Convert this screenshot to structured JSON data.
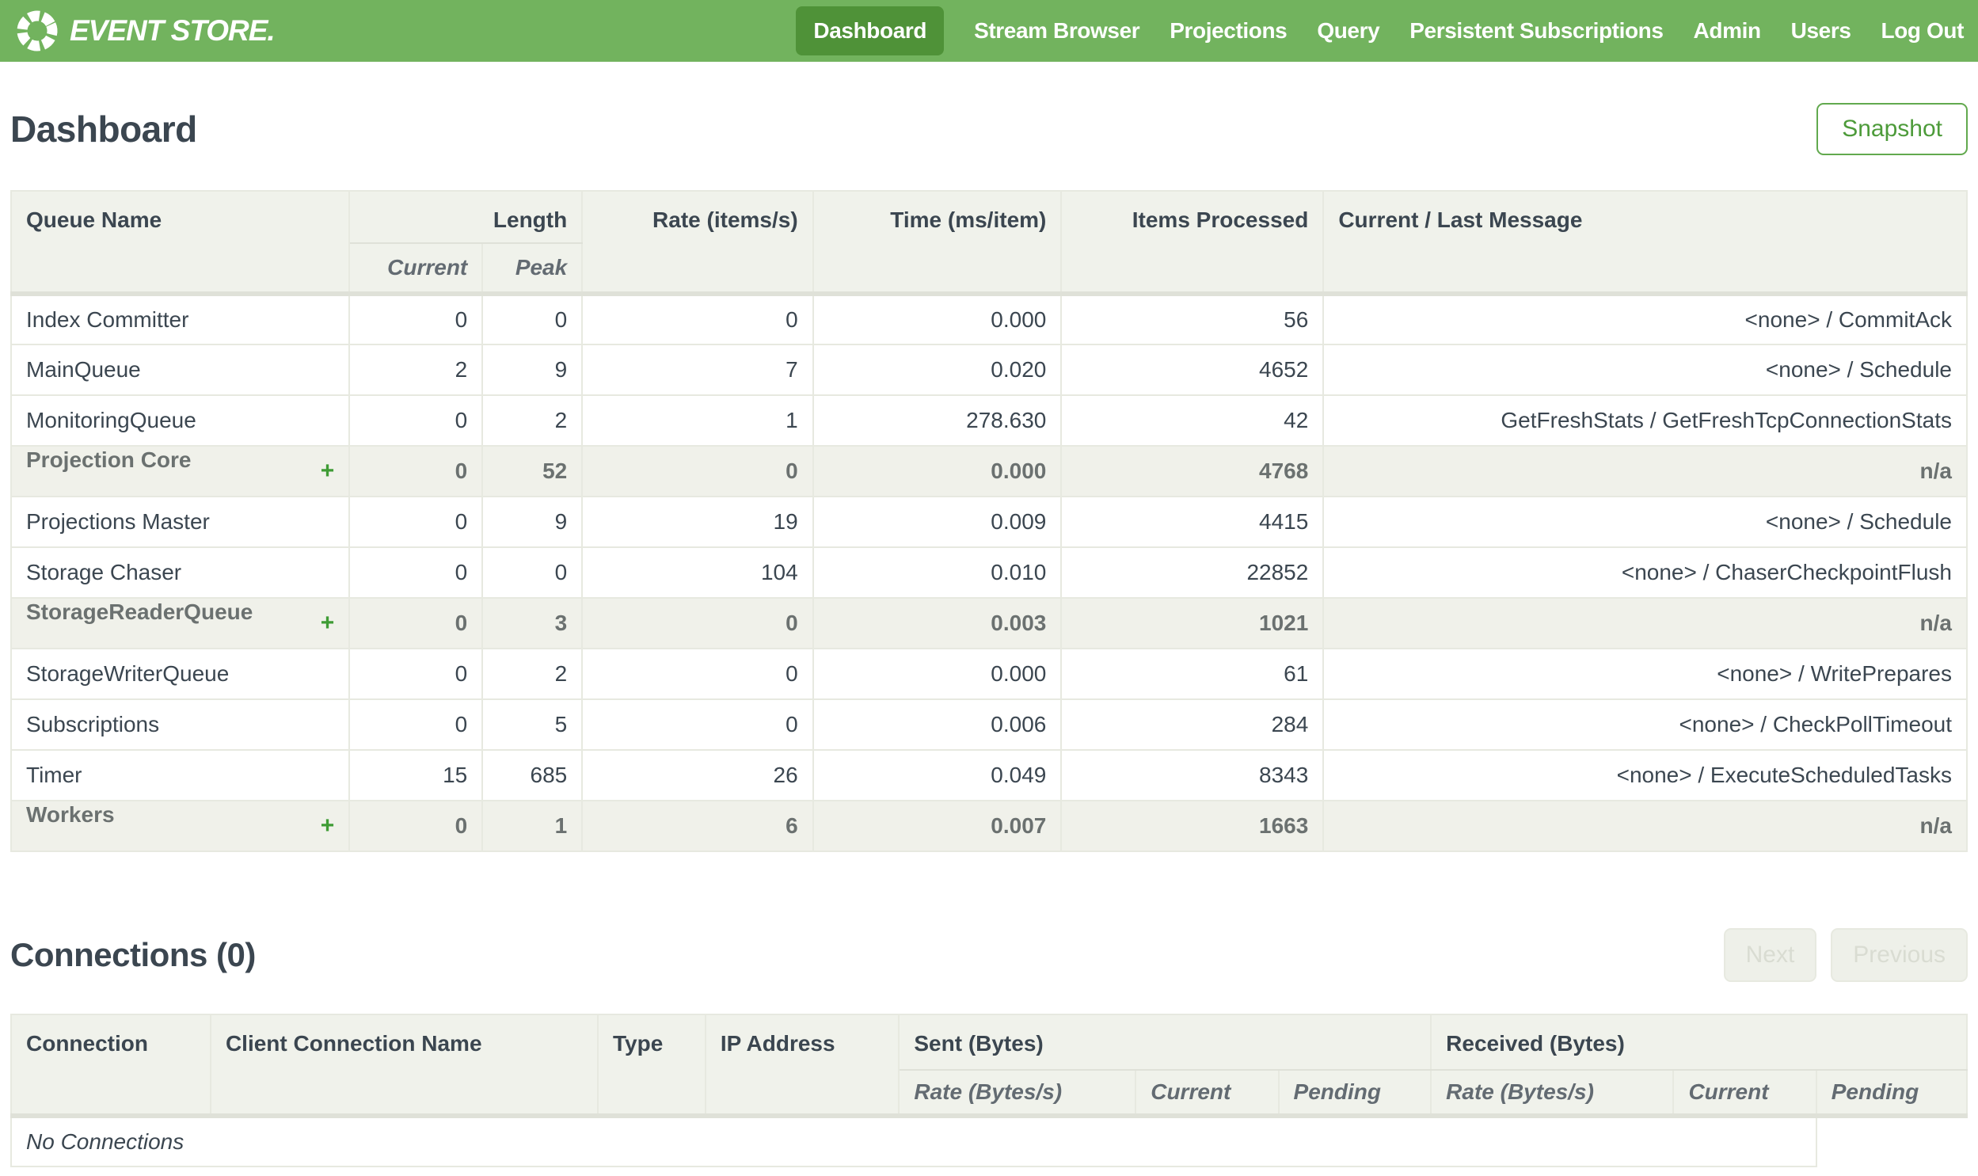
{
  "nav": {
    "brand": "EVENT STORE.",
    "items": [
      {
        "label": "Dashboard",
        "active": true
      },
      {
        "label": "Stream Browser",
        "active": false
      },
      {
        "label": "Projections",
        "active": false
      },
      {
        "label": "Query",
        "active": false
      },
      {
        "label": "Persistent Subscriptions",
        "active": false
      },
      {
        "label": "Admin",
        "active": false
      },
      {
        "label": "Users",
        "active": false
      },
      {
        "label": "Log Out",
        "active": false
      }
    ]
  },
  "page": {
    "title": "Dashboard",
    "snapshot_label": "Snapshot"
  },
  "queue_table": {
    "headers": {
      "queue_name": "Queue Name",
      "length": "Length",
      "current": "Current",
      "peak": "Peak",
      "rate": "Rate (items/s)",
      "time": "Time (ms/item)",
      "items_processed": "Items Processed",
      "message": "Current / Last Message"
    },
    "expand_symbol": "+",
    "rows": [
      {
        "name": "Index Committer",
        "group": false,
        "current": "0",
        "peak": "0",
        "rate": "0",
        "time": "0.000",
        "items": "56",
        "message": "<none> / CommitAck"
      },
      {
        "name": "MainQueue",
        "group": false,
        "current": "2",
        "peak": "9",
        "rate": "7",
        "time": "0.020",
        "items": "4652",
        "message": "<none> / Schedule"
      },
      {
        "name": "MonitoringQueue",
        "group": false,
        "current": "0",
        "peak": "2",
        "rate": "1",
        "time": "278.630",
        "items": "42",
        "message": "GetFreshStats / GetFreshTcpConnectionStats"
      },
      {
        "name": "Projection Core",
        "group": true,
        "current": "0",
        "peak": "52",
        "rate": "0",
        "time": "0.000",
        "items": "4768",
        "message": "n/a"
      },
      {
        "name": "Projections Master",
        "group": false,
        "current": "0",
        "peak": "9",
        "rate": "19",
        "time": "0.009",
        "items": "4415",
        "message": "<none> / Schedule"
      },
      {
        "name": "Storage Chaser",
        "group": false,
        "current": "0",
        "peak": "0",
        "rate": "104",
        "time": "0.010",
        "items": "22852",
        "message": "<none> / ChaserCheckpointFlush"
      },
      {
        "name": "StorageReaderQueue",
        "group": true,
        "current": "0",
        "peak": "3",
        "rate": "0",
        "time": "0.003",
        "items": "1021",
        "message": "n/a"
      },
      {
        "name": "StorageWriterQueue",
        "group": false,
        "current": "0",
        "peak": "2",
        "rate": "0",
        "time": "0.000",
        "items": "61",
        "message": "<none> / WritePrepares"
      },
      {
        "name": "Subscriptions",
        "group": false,
        "current": "0",
        "peak": "5",
        "rate": "0",
        "time": "0.006",
        "items": "284",
        "message": "<none> / CheckPollTimeout"
      },
      {
        "name": "Timer",
        "group": false,
        "current": "15",
        "peak": "685",
        "rate": "26",
        "time": "0.049",
        "items": "8343",
        "message": "<none> / ExecuteScheduledTasks"
      },
      {
        "name": "Workers",
        "group": true,
        "current": "0",
        "peak": "1",
        "rate": "6",
        "time": "0.007",
        "items": "1663",
        "message": "n/a"
      }
    ]
  },
  "connections": {
    "title": "Connections (0)",
    "next_label": "Next",
    "previous_label": "Previous",
    "headers": {
      "connection": "Connection",
      "client_name": "Client Connection Name",
      "type": "Type",
      "ip": "IP Address",
      "sent": "Sent (Bytes)",
      "received": "Received (Bytes)",
      "rate": "Rate (Bytes/s)",
      "current": "Current",
      "pending": "Pending"
    },
    "empty_message": "No Connections"
  },
  "colors": {
    "nav_green": "#72b35e",
    "nav_active_green": "#4f9238",
    "accent_green": "#4d9b3a",
    "heading_text": "#3b4650",
    "table_header_bg": "#f0f2eb",
    "group_row_bg": "#f0f1ea"
  }
}
